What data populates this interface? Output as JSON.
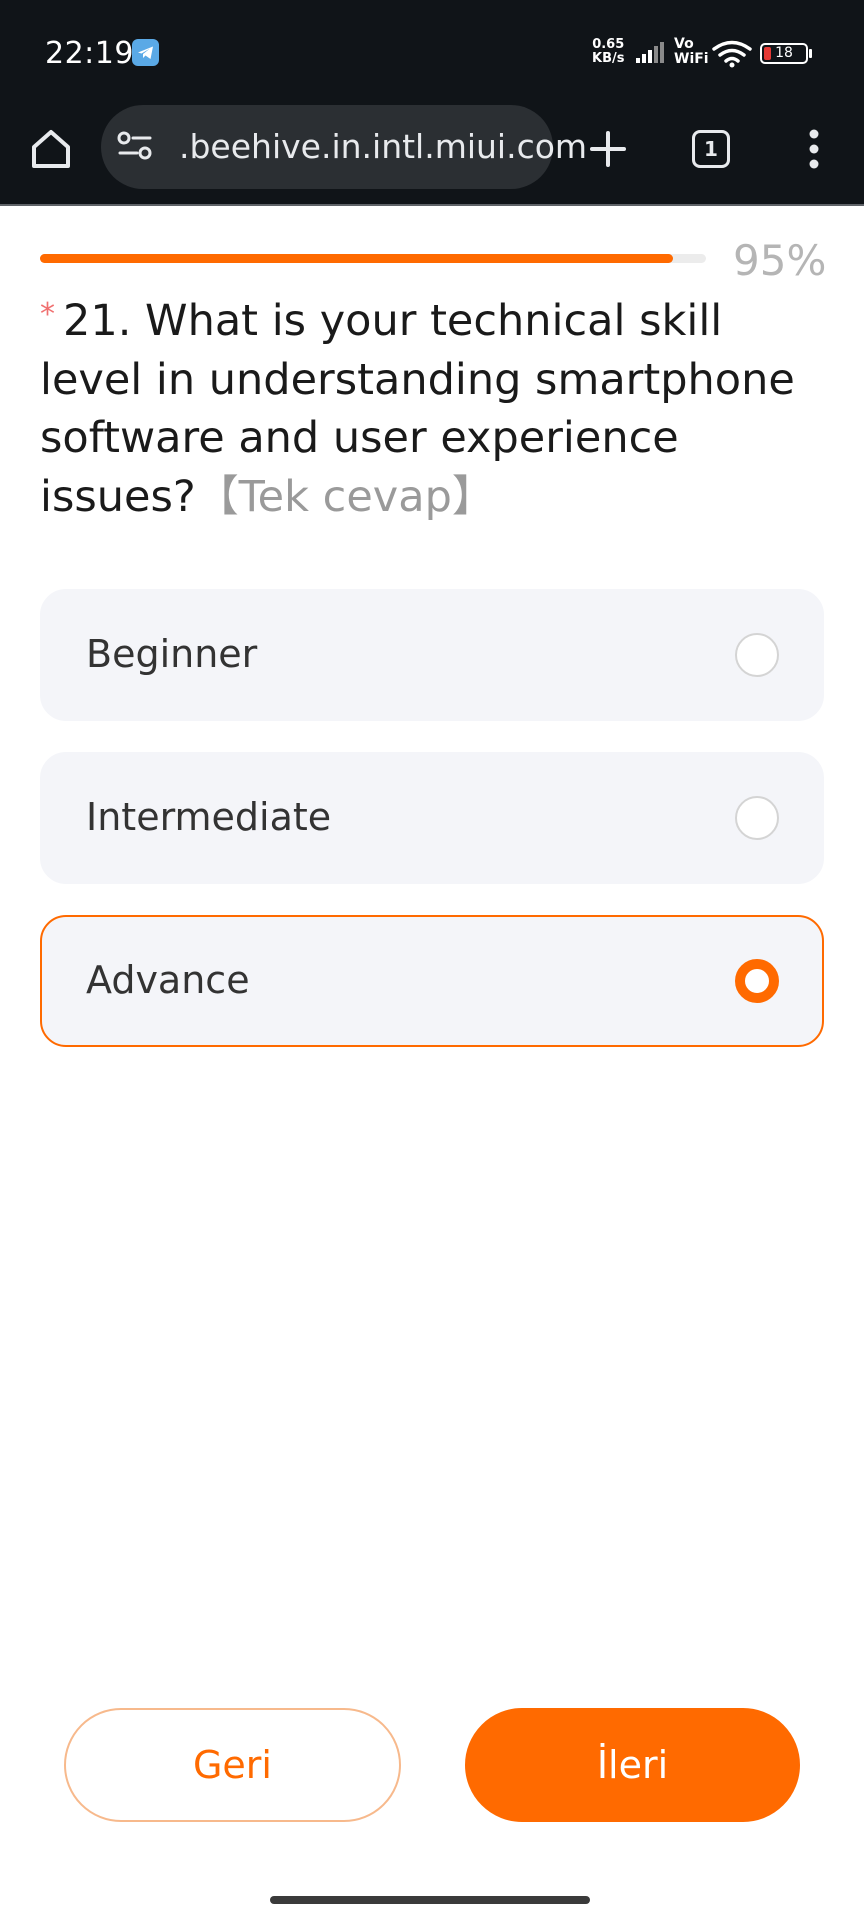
{
  "status_bar": {
    "time": "22:19",
    "net_speed_value": "0.65",
    "net_speed_unit": "KB/s",
    "vowifi_top": "Vo",
    "vowifi_bottom": "WiFi",
    "battery_level": "18",
    "icons": [
      "telegram-icon",
      "signal-icon",
      "wifi-icon",
      "battery-icon"
    ]
  },
  "browser": {
    "url_prefix": "",
    "url": ".beehive.in.intl.miui.com",
    "tab_count": "1",
    "icons": [
      "home-icon",
      "tune-icon",
      "plus-icon",
      "more-vert-icon"
    ]
  },
  "survey": {
    "progress_label": "95%",
    "progress_fraction": 0.95,
    "required_mark": "*",
    "question": "21. What is your technical skill level in understanding smartphone software and user experience issues?",
    "hint": "【Tek cevap】",
    "options": [
      {
        "label": "Beginner",
        "selected": false
      },
      {
        "label": "Intermediate",
        "selected": false
      },
      {
        "label": "Advance",
        "selected": true
      }
    ],
    "back_label": "Geri",
    "next_label": "İleri"
  },
  "colors": {
    "accent": "#ff6a00",
    "toolbar_bg": "#101418",
    "option_bg": "#f4f5f9"
  }
}
